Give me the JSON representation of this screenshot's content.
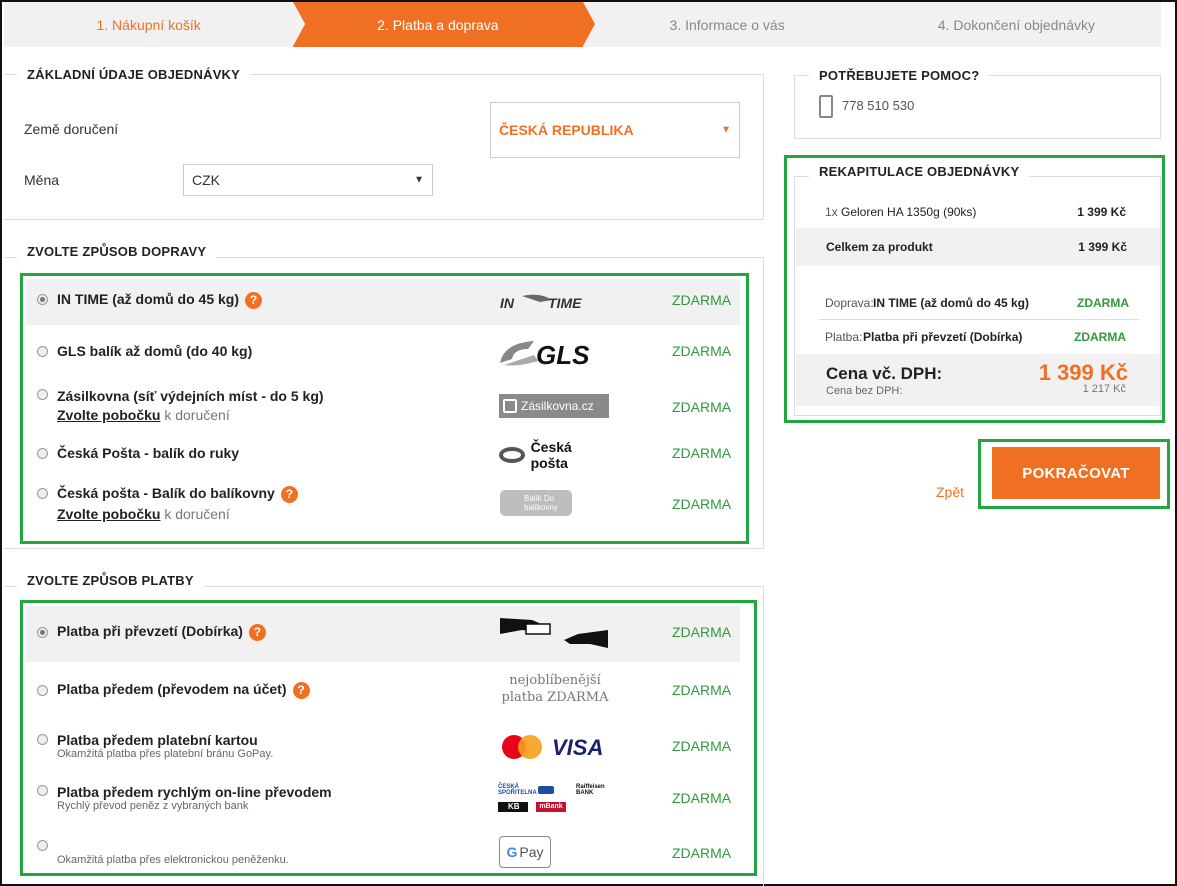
{
  "steps": [
    "1. Nákupní košík",
    "2. Platba a doprava",
    "3. Informace o vás",
    "4. Dokončení objednávky"
  ],
  "basic": {
    "title": "ZÁKLADNÍ ÚDAJE OBJEDNÁVKY",
    "country_label": "Země doručení",
    "country_value": "ČESKÁ REPUBLIKA",
    "currency_label": "Měna",
    "currency_value": "CZK"
  },
  "shipping": {
    "title": "ZVOLTE ZPŮSOB DOPRAVY",
    "pick_link": "Zvolte pobočku",
    "pick_suffix": "k doručení",
    "price": "ZDARMA",
    "options": [
      {
        "label": "IN TIME (až domů do 45 kg)",
        "logo": "IN TIME"
      },
      {
        "label": "GLS balík až domů (do 40 kg)",
        "logo": "GLS"
      },
      {
        "label": "Zásilkovna (síť výdejních míst - do 5 kg)",
        "logo": "Zásilkovna.cz"
      },
      {
        "label": "Česká Pošta - balík do ruky",
        "logo": "Česká pošta"
      },
      {
        "label": "Česká pošta - Balík do balíkovny",
        "logo": "Balík Do balíkovny"
      }
    ]
  },
  "payment": {
    "title": "ZVOLTE ZPŮSOB PLATBY",
    "price": "ZDARMA",
    "options": [
      {
        "label": "Platba při převzetí (Dobírka)",
        "sub": ""
      },
      {
        "label": "Platba předem (převodem na účet)",
        "sub": ""
      },
      {
        "label": "Platba předem platební kartou",
        "sub": "Okamžitá platba přes platební bránu GoPay."
      },
      {
        "label": "Platba předem rychlým on-line převodem",
        "sub": "Rychlý převod peněz z vybraných bank"
      },
      {
        "label": "",
        "sub": "Okamžitá platba přes elektronickou peněženku."
      }
    ],
    "promo_line1": "nejoblíbenější",
    "promo_line2": "platba ZDARMA",
    "visa": "VISA",
    "gpay": "Pay",
    "bank1": "ČESKÁ SPOŘITELNA",
    "bank2": "Raiffeisen BANK",
    "bank3": "KB",
    "bank4": "mBank"
  },
  "help": {
    "title": "POTŘEBUJETE POMOC?",
    "phone": "778 510 530"
  },
  "summary": {
    "title": "REKAPITULACE OBJEDNÁVKY",
    "item_qty": "1x",
    "item_name": "Geloren HA 1350g (90ks)",
    "item_price": "1 399 Kč",
    "subtotal_label": "Celkem za produkt",
    "subtotal_value": "1 399 Kč",
    "shipping_label": "Doprava:",
    "shipping_value": "IN TIME (až domů do 45 kg)",
    "shipping_price": "ZDARMA",
    "payment_label": "Platba:",
    "payment_value": "Platba při převzetí (Dobírka)",
    "payment_price": "ZDARMA",
    "total_label": "Cena vč. DPH:",
    "total_value": "1 399 Kč",
    "net_label": "Cena bez DPH:",
    "net_value": "1 217 Kč"
  },
  "actions": {
    "back": "Zpět",
    "continue": "POKRAČOVAT"
  },
  "colors": {
    "accent": "#f07023",
    "highlight": "#22a641",
    "free": "#2f9a3b"
  }
}
